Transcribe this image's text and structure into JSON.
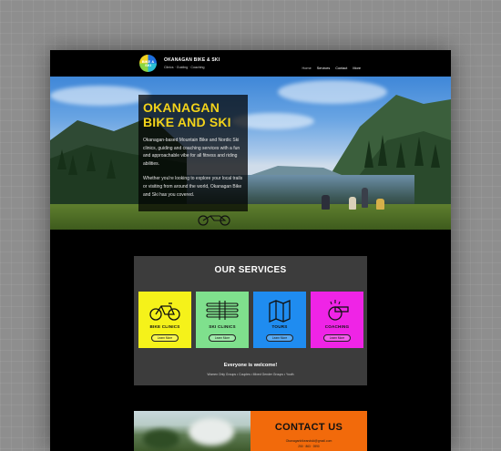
{
  "header": {
    "logo_text": "BIKE & SKI",
    "brand_name": "OKANAGAN BIKE & SKI",
    "tagline": "Clinics · Guiding · Coaching",
    "nav": [
      "Home",
      "Services",
      "Contact",
      "More"
    ]
  },
  "hero": {
    "title_line1": "OKANAGAN",
    "title_line2": "BIKE AND SKI",
    "paragraph1": "Okanagan-based Mountain Bike and Nordic Ski clinics, guiding and coaching services with a fun and approachable vibe for all fitness and riding abilities.",
    "paragraph2": "Whether you're looking to explore your local trails or visiting from around the world, Okanagan Bike and Ski has you covered."
  },
  "services": {
    "title": "OUR SERVICES",
    "cards": [
      {
        "label": "BIKE CLINICS",
        "button": "Learn More",
        "color": "#f5f21a",
        "icon": "bicycle-icon"
      },
      {
        "label": "SKI CLINICS",
        "button": "Learn More",
        "color": "#7fe08d",
        "icon": "skis-icon"
      },
      {
        "label": "TOURS",
        "button": "Learn More",
        "color": "#1f8cf0",
        "icon": "map-icon"
      },
      {
        "label": "COACHING",
        "button": "Learn More",
        "color": "#ef24e6",
        "icon": "whistle-icon"
      }
    ],
    "welcome": "Everyone is welcome!",
    "groups": "Women Only Groups • Couples • Mixed Gender Groups • Youth"
  },
  "contact": {
    "title": "CONTACT US",
    "email": "Okanaganbikeandski@gmail.com",
    "phone": "250 · 863 · 3990"
  },
  "colors": {
    "accent_yellow": "#f3d31a",
    "contact_orange": "#f26a0b",
    "services_bg": "#3c3c3c"
  }
}
